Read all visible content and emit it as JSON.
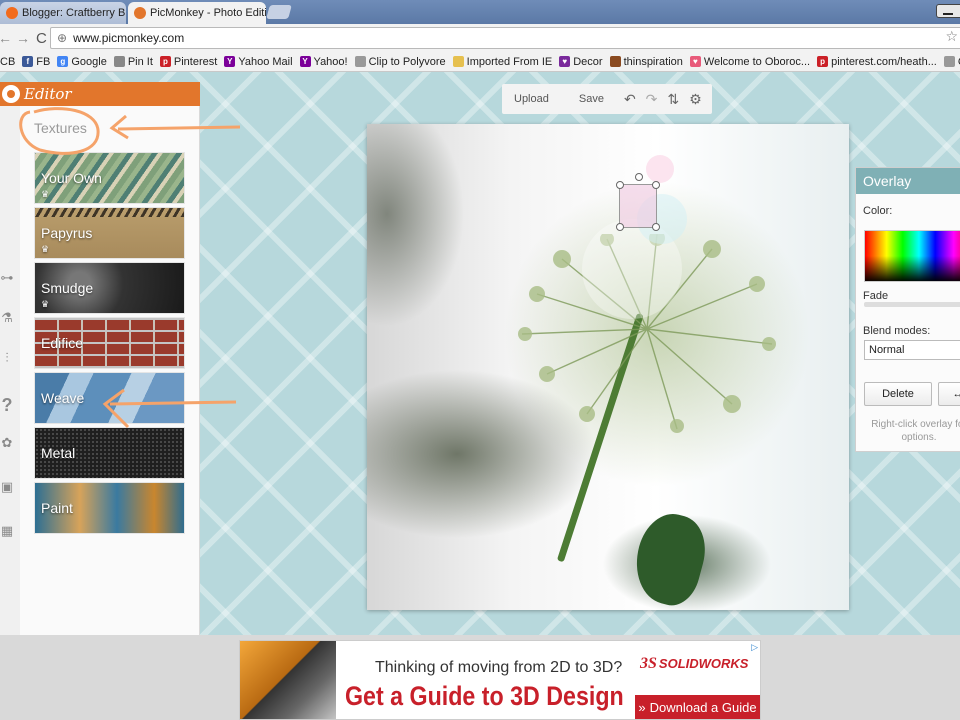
{
  "browser": {
    "tabs": [
      {
        "title": "Blogger: Craftberry Bush -",
        "favicon_color": "#f26b1d",
        "active": false
      },
      {
        "title": "PicMonkey - Photo Editing",
        "favicon_color": "#e2762c",
        "active": true
      }
    ],
    "close_glyph": "×",
    "url": "www.picmonkey.com",
    "nav": {
      "back": "←",
      "forward": "→",
      "reload": "C",
      "star": "☆",
      "globe": "⊕"
    },
    "bookmarks": [
      {
        "label": "CB",
        "icon_color": "",
        "icon_text": ""
      },
      {
        "label": "FB",
        "icon_color": "#3b5998",
        "icon_text": "f"
      },
      {
        "label": "Google",
        "icon_color": "#4285f4",
        "icon_text": "g"
      },
      {
        "label": "Pin It",
        "icon_color": "#888888",
        "icon_text": ""
      },
      {
        "label": "Pinterest",
        "icon_color": "#cb2027",
        "icon_text": "p"
      },
      {
        "label": "Yahoo Mail",
        "icon_color": "#7b0099",
        "icon_text": "Y"
      },
      {
        "label": "Yahoo!",
        "icon_color": "#7b0099",
        "icon_text": "Y"
      },
      {
        "label": "Clip to Polyvore",
        "icon_color": "#999999",
        "icon_text": ""
      },
      {
        "label": "Imported From IE",
        "icon_color": "#e6c04f",
        "icon_text": ""
      },
      {
        "label": "Decor",
        "icon_color": "#7a2a9c",
        "icon_text": "♥"
      },
      {
        "label": "thinspiration",
        "icon_color": "#8a4a20",
        "icon_text": ""
      },
      {
        "label": "Welcome to Oboroc...",
        "icon_color": "#e85a7a",
        "icon_text": "♥"
      },
      {
        "label": "pinterest.com/heath...",
        "icon_color": "#cb2027",
        "icon_text": "p"
      },
      {
        "label": "Creative Co-Op - W...",
        "icon_color": "#999999",
        "icon_text": ""
      }
    ]
  },
  "editor": {
    "title": "Editor",
    "section_title": "Textures",
    "textures": [
      {
        "label": "Your Own",
        "premium": true
      },
      {
        "label": "Papyrus",
        "premium": true
      },
      {
        "label": "Smudge",
        "premium": true
      },
      {
        "label": "Edifice",
        "premium": false
      },
      {
        "label": "Weave",
        "premium": false
      },
      {
        "label": "Metal",
        "premium": false
      },
      {
        "label": "Paint",
        "premium": false
      }
    ],
    "crown_glyph": "♛",
    "tool_glyphs": [
      "⊶",
      "⚗",
      "⫶",
      "?",
      "✿",
      "▣",
      "▦"
    ],
    "toolbar": {
      "upload": "Upload",
      "save": "Save",
      "undo": "↶",
      "redo": "↷",
      "layers": "⇅",
      "settings": "⚙"
    }
  },
  "overlay_panel": {
    "title": "Overlay",
    "color_label": "Color:",
    "fade_label": "Fade",
    "blend_label": "Blend modes:",
    "blend_value": "Normal",
    "delete_label": "Delete",
    "flip_label": "↔",
    "hint": "Right-click overlay for options."
  },
  "ad": {
    "headline": "Thinking of moving from 2D to 3D?",
    "cta": "Get a Guide to 3D Design",
    "brand": "SOLIDWORKS",
    "brand_mark": "3S",
    "download": "Download a Guide",
    "download_icon": "»",
    "adchoices": "▷"
  },
  "colors": {
    "accent_orange": "#e2762c",
    "panel_teal": "#7fb0b5",
    "annotation": "#f5a36a",
    "ad_red": "#c8202a"
  }
}
